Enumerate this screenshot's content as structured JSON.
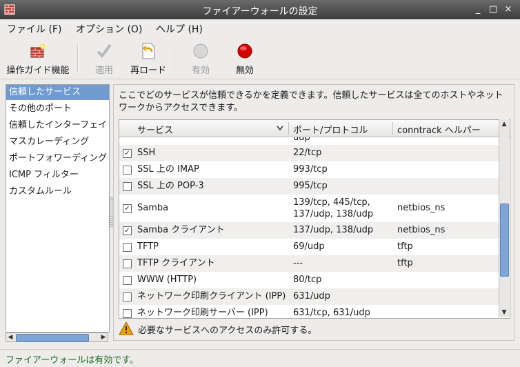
{
  "window": {
    "title": "ファイアーウォールの設定",
    "minimize": "_",
    "maximize": "□",
    "close": "×"
  },
  "menu": [
    "ファイル (F)",
    "オプション (O)",
    "ヘルプ (H)"
  ],
  "toolbar": {
    "wizard": "操作ガイド機能",
    "apply": "適用",
    "reload": "再ロード",
    "enable": "有効",
    "disable": "無効"
  },
  "sidebar": {
    "items": [
      "信頼したサービス",
      "その他のポート",
      "信頼したインターフェイ",
      "マスカレーディング",
      "ポートフォワーディング",
      "ICMP フィルター",
      "カスタムルール"
    ],
    "selected_index": 0
  },
  "main": {
    "description": "ここでどのサービスが信頼できるかを定義できます。信頼したサービスは全てのホストやネットワークからアクセスできます。",
    "columns": [
      "サービス",
      "ポート/プロトコル",
      "conntrack ヘルパー"
    ],
    "partial_top": "udp",
    "rows": [
      {
        "checked": true,
        "service": "SSH",
        "ports": "22/tcp",
        "helper": ""
      },
      {
        "checked": false,
        "service": "SSL 上の IMAP",
        "ports": "993/tcp",
        "helper": ""
      },
      {
        "checked": false,
        "service": "SSL 上の POP-3",
        "ports": "995/tcp",
        "helper": ""
      },
      {
        "checked": true,
        "service": "Samba",
        "ports": "139/tcp, 445/tcp, 137/udp, 138/udp",
        "ports_line1": "139/tcp, 445/tcp,",
        "ports_line2": "137/udp, 138/udp",
        "helper": "netbios_ns"
      },
      {
        "checked": true,
        "service": "Samba クライアント",
        "ports": "137/udp, 138/udp",
        "helper": "netbios_ns"
      },
      {
        "checked": false,
        "service": "TFTP",
        "ports": "69/udp",
        "helper": "tftp"
      },
      {
        "checked": false,
        "service": "TFTP クライアント",
        "ports": "---",
        "helper": "tftp"
      },
      {
        "checked": false,
        "service": "WWW (HTTP)",
        "ports": "80/tcp",
        "helper": ""
      },
      {
        "checked": false,
        "service": "ネットワーク印刷クライアント (IPP)",
        "ports": "631/udp",
        "helper": ""
      },
      {
        "checked": false,
        "service": "ネットワーク印刷サーバー (IPP)",
        "ports": "631/tcp, 631/udp",
        "helper": ""
      }
    ],
    "warning": "必要なサービスへのアクセスのみ許可する。"
  },
  "status": "ファイアーウォールは有効です。",
  "colors": {
    "selection": "#6f9bd1",
    "status_text": "#1d6b1d",
    "disable_red": "#d40000"
  }
}
